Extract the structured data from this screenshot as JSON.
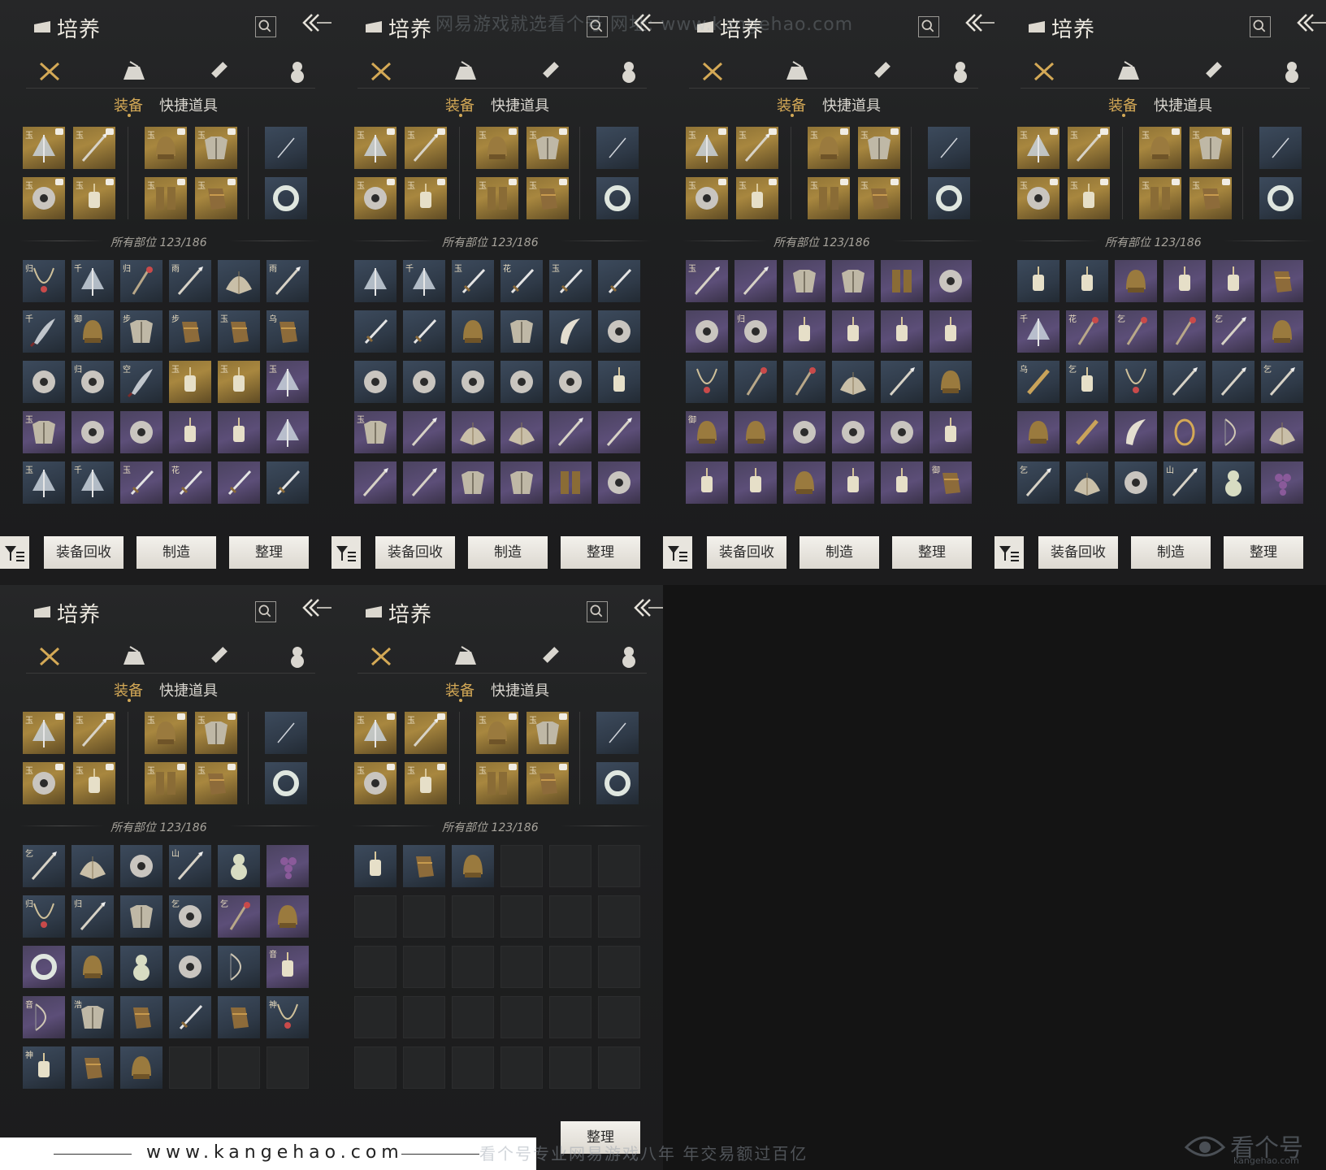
{
  "header": {
    "title": "培养"
  },
  "category_tabs": [
    "swords-icon",
    "pouch-icon",
    "scroll-icon",
    "gourd-icon"
  ],
  "sub_tabs": {
    "equipment": "装备",
    "quick_items": "快捷道具"
  },
  "count_label": "所有部位 123/186",
  "buttons": {
    "recycle": "装备回收",
    "craft": "制造",
    "sort": "整理"
  },
  "watermark": {
    "top": "网易游戏就选看个号  网址: www.kangehao.com",
    "url": "www.kangehao.com",
    "slogan": "看个号专业网易游戏八年  年交易额过百亿",
    "logo": "看个号",
    "logo_sub": "kangehao.com"
  },
  "colors": {
    "accent": "#d4a956",
    "gold_slot": "#a8873f",
    "blue_slot": "#2f3a48",
    "purple_slot": "#5c4e78"
  },
  "equipped": {
    "row1": [
      {
        "rarity": "gold",
        "icon": "umbrella-icon",
        "tag": "玉"
      },
      {
        "rarity": "gold",
        "icon": "spear-icon",
        "tag": "玉"
      },
      {
        "rarity": "gold",
        "icon": "helmet-icon",
        "tag": "玉"
      },
      {
        "rarity": "gold",
        "icon": "armor-icon",
        "tag": "玉"
      },
      {
        "rarity": "blue",
        "icon": "needle-icon",
        "tag": ""
      }
    ],
    "row2": [
      {
        "rarity": "gold",
        "icon": "ring-icon",
        "tag": "玉"
      },
      {
        "rarity": "gold",
        "icon": "pendant-icon",
        "tag": "玉"
      },
      {
        "rarity": "gold",
        "icon": "greaves-icon",
        "tag": "玉"
      },
      {
        "rarity": "gold",
        "icon": "bracer-icon",
        "tag": "玉"
      },
      {
        "rarity": "blue",
        "icon": "bangle-icon",
        "tag": ""
      }
    ]
  },
  "pages": [
    {
      "label": "page-1",
      "cells": [
        [
          "blue",
          "necklace-icon",
          "归"
        ],
        [
          "blue",
          "umbrella-icon",
          "千"
        ],
        [
          "blue",
          "staff-icon",
          "归"
        ],
        [
          "blue",
          "spear-icon",
          "雨"
        ],
        [
          "blue",
          "fan-icon",
          ""
        ],
        [
          "blue",
          "spear-icon",
          "雨"
        ],
        [
          "blue",
          "blade-icon",
          "千"
        ],
        [
          "blue",
          "helmet-icon",
          "御"
        ],
        [
          "blue",
          "armor-icon",
          "步"
        ],
        [
          "blue",
          "bracer-icon",
          "步"
        ],
        [
          "blue",
          "bracer-icon",
          "玉"
        ],
        [
          "blue",
          "bracer-icon",
          "乌"
        ],
        [
          "blue",
          "ring-icon",
          ""
        ],
        [
          "blue",
          "ring-icon",
          "归"
        ],
        [
          "blue",
          "blade-icon",
          "空"
        ],
        [
          "gold",
          "pendant-icon",
          "玉"
        ],
        [
          "gold",
          "pendant-icon",
          "玉"
        ],
        [
          "purple",
          "umbrella-icon",
          "玉"
        ],
        [
          "purple",
          "armor-icon",
          "玉"
        ],
        [
          "purple",
          "ring-icon",
          ""
        ],
        [
          "purple",
          "ring-icon",
          ""
        ],
        [
          "purple",
          "pendant-icon",
          ""
        ],
        [
          "purple",
          "pendant-icon",
          ""
        ],
        [
          "purple",
          "umbrella-icon",
          ""
        ],
        [
          "blue",
          "umbrella-icon",
          "玉"
        ],
        [
          "blue",
          "umbrella-icon",
          "千"
        ],
        [
          "purple",
          "sword-icon",
          "玉"
        ],
        [
          "purple",
          "sword-icon",
          "花"
        ],
        [
          "purple",
          "sword-icon",
          ""
        ],
        [
          "blue",
          "sword-icon",
          ""
        ]
      ]
    },
    {
      "label": "page-2",
      "cells": [
        [
          "blue",
          "umbrella-icon",
          ""
        ],
        [
          "blue",
          "umbrella-icon",
          "千"
        ],
        [
          "blue",
          "sword-icon",
          "玉"
        ],
        [
          "blue",
          "sword-icon",
          "花"
        ],
        [
          "blue",
          "sword-icon",
          "玉"
        ],
        [
          "blue",
          "sword-icon",
          ""
        ],
        [
          "blue",
          "sword-icon",
          ""
        ],
        [
          "blue",
          "sword-icon",
          ""
        ],
        [
          "blue",
          "helmet-icon",
          ""
        ],
        [
          "blue",
          "armor-icon",
          ""
        ],
        [
          "blue",
          "horn-icon",
          ""
        ],
        [
          "blue",
          "ring-icon",
          ""
        ],
        [
          "blue",
          "ring-icon",
          ""
        ],
        [
          "blue",
          "ring-icon",
          ""
        ],
        [
          "blue",
          "ring-icon",
          ""
        ],
        [
          "blue",
          "ring-icon",
          ""
        ],
        [
          "blue",
          "ring-icon",
          ""
        ],
        [
          "blue",
          "pendant-icon",
          ""
        ],
        [
          "purple",
          "armor-icon",
          "玉"
        ],
        [
          "purple",
          "spear-icon",
          ""
        ],
        [
          "purple",
          "fan-icon",
          ""
        ],
        [
          "purple",
          "fan-icon",
          ""
        ],
        [
          "purple",
          "spear-icon",
          ""
        ],
        [
          "purple",
          "spear-icon",
          ""
        ],
        [
          "purple",
          "spear-icon",
          ""
        ],
        [
          "purple",
          "spear-icon",
          ""
        ],
        [
          "purple",
          "armor-icon",
          ""
        ],
        [
          "purple",
          "armor-icon",
          ""
        ],
        [
          "purple",
          "greaves-icon",
          ""
        ],
        [
          "purple",
          "ring-icon",
          ""
        ]
      ]
    },
    {
      "label": "page-3",
      "cells": [
        [
          "purple",
          "spear-icon",
          "玉"
        ],
        [
          "purple",
          "spear-icon",
          ""
        ],
        [
          "purple",
          "armor-icon",
          ""
        ],
        [
          "purple",
          "armor-icon",
          ""
        ],
        [
          "purple",
          "greaves-icon",
          ""
        ],
        [
          "purple",
          "ring-icon",
          ""
        ],
        [
          "purple",
          "ring-icon",
          ""
        ],
        [
          "purple",
          "ring-icon",
          "归"
        ],
        [
          "purple",
          "pendant-icon",
          ""
        ],
        [
          "purple",
          "pendant-icon",
          ""
        ],
        [
          "purple",
          "pendant-icon",
          ""
        ],
        [
          "purple",
          "pendant-icon",
          ""
        ],
        [
          "blue",
          "necklace-icon",
          ""
        ],
        [
          "blue",
          "staff-icon",
          ""
        ],
        [
          "blue",
          "staff-icon",
          ""
        ],
        [
          "blue",
          "fan-icon",
          ""
        ],
        [
          "blue",
          "spear-icon",
          ""
        ],
        [
          "blue",
          "helmet-icon",
          ""
        ],
        [
          "purple",
          "helmet-icon",
          "御"
        ],
        [
          "purple",
          "helmet-icon",
          ""
        ],
        [
          "purple",
          "ring-icon",
          ""
        ],
        [
          "purple",
          "ring-icon",
          ""
        ],
        [
          "purple",
          "ring-icon",
          ""
        ],
        [
          "purple",
          "pendant-icon",
          ""
        ],
        [
          "purple",
          "pendant-icon",
          ""
        ],
        [
          "purple",
          "pendant-icon",
          ""
        ],
        [
          "purple",
          "helmet-icon",
          ""
        ],
        [
          "purple",
          "pendant-icon",
          ""
        ],
        [
          "purple",
          "pendant-icon",
          ""
        ],
        [
          "purple",
          "bracer-icon",
          "御"
        ]
      ]
    },
    {
      "label": "page-4",
      "cells": [
        [
          "blue",
          "pendant-icon",
          ""
        ],
        [
          "blue",
          "pendant-icon",
          ""
        ],
        [
          "purple",
          "helmet-icon",
          ""
        ],
        [
          "purple",
          "pendant-icon",
          ""
        ],
        [
          "purple",
          "pendant-icon",
          ""
        ],
        [
          "purple",
          "bracer-icon",
          ""
        ],
        [
          "purple",
          "umbrella-icon",
          "千"
        ],
        [
          "purple",
          "staff-icon",
          "花"
        ],
        [
          "purple",
          "staff-icon",
          "乞"
        ],
        [
          "purple",
          "staff-icon",
          ""
        ],
        [
          "purple",
          "spear-icon",
          "乞"
        ],
        [
          "purple",
          "helmet-icon",
          ""
        ],
        [
          "blue",
          "flute-icon",
          "乌"
        ],
        [
          "blue",
          "pendant-icon",
          "乞"
        ],
        [
          "blue",
          "necklace-icon",
          ""
        ],
        [
          "blue",
          "spear-icon",
          ""
        ],
        [
          "blue",
          "spear-icon",
          ""
        ],
        [
          "blue",
          "spear-icon",
          "乞"
        ],
        [
          "purple",
          "helmet-icon",
          ""
        ],
        [
          "purple",
          "flute-icon",
          ""
        ],
        [
          "purple",
          "horn-icon",
          ""
        ],
        [
          "purple",
          "cage-icon",
          ""
        ],
        [
          "purple",
          "bow-icon",
          ""
        ],
        [
          "purple",
          "fan-icon",
          ""
        ],
        [
          "blue",
          "spear-icon",
          "乞"
        ],
        [
          "blue",
          "fan-icon",
          ""
        ],
        [
          "blue",
          "ring-icon",
          ""
        ],
        [
          "blue",
          "spear-icon",
          "山"
        ],
        [
          "blue",
          "gourd-icon",
          ""
        ],
        [
          "purple",
          "grapes-icon",
          ""
        ]
      ]
    },
    {
      "label": "page-5",
      "cells": [
        [
          "blue",
          "spear-icon",
          "乞"
        ],
        [
          "blue",
          "fan-icon",
          ""
        ],
        [
          "blue",
          "ring-icon",
          ""
        ],
        [
          "blue",
          "spear-icon",
          "山"
        ],
        [
          "blue",
          "gourd-icon",
          ""
        ],
        [
          "purple",
          "grapes-icon",
          ""
        ],
        [
          "blue",
          "necklace-icon",
          "归"
        ],
        [
          "blue",
          "spear-icon",
          "归"
        ],
        [
          "blue",
          "armor-icon",
          ""
        ],
        [
          "blue",
          "ring-icon",
          "乞"
        ],
        [
          "purple",
          "staff-icon",
          "乞"
        ],
        [
          "purple",
          "helmet-icon",
          ""
        ],
        [
          "purple",
          "bangle-icon",
          ""
        ],
        [
          "blue",
          "helmet-icon",
          ""
        ],
        [
          "blue",
          "gourd-icon",
          ""
        ],
        [
          "blue",
          "ring-icon",
          ""
        ],
        [
          "blue",
          "bow-icon",
          ""
        ],
        [
          "purple",
          "pendant-icon",
          "音"
        ],
        [
          "purple",
          "bow-icon",
          "音"
        ],
        [
          "blue",
          "armor-icon",
          "浩"
        ],
        [
          "blue",
          "bracer-icon",
          ""
        ],
        [
          "blue",
          "sword-icon",
          ""
        ],
        [
          "blue",
          "bracer-icon",
          ""
        ],
        [
          "blue",
          "necklace-icon",
          "神"
        ],
        [
          "blue",
          "pendant-icon",
          "神"
        ],
        [
          "blue",
          "bracer-icon",
          ""
        ],
        [
          "blue",
          "helmet-icon",
          ""
        ],
        [
          "empty",
          "",
          ""
        ],
        [
          "empty",
          "",
          ""
        ],
        [
          "empty",
          "",
          ""
        ]
      ]
    },
    {
      "label": "page-6",
      "cells": [
        [
          "blue",
          "pendant-icon",
          ""
        ],
        [
          "blue",
          "bracer-icon",
          ""
        ],
        [
          "blue",
          "helmet-icon",
          ""
        ],
        [
          "empty",
          "",
          ""
        ],
        [
          "empty",
          "",
          ""
        ],
        [
          "empty",
          "",
          ""
        ],
        [
          "empty",
          "",
          ""
        ],
        [
          "empty",
          "",
          ""
        ],
        [
          "empty",
          "",
          ""
        ],
        [
          "empty",
          "",
          ""
        ],
        [
          "empty",
          "",
          ""
        ],
        [
          "empty",
          "",
          ""
        ],
        [
          "empty",
          "",
          ""
        ],
        [
          "empty",
          "",
          ""
        ],
        [
          "empty",
          "",
          ""
        ],
        [
          "empty",
          "",
          ""
        ],
        [
          "empty",
          "",
          ""
        ],
        [
          "empty",
          "",
          ""
        ],
        [
          "empty",
          "",
          ""
        ],
        [
          "empty",
          "",
          ""
        ],
        [
          "empty",
          "",
          ""
        ],
        [
          "empty",
          "",
          ""
        ],
        [
          "empty",
          "",
          ""
        ],
        [
          "empty",
          "",
          ""
        ],
        [
          "empty",
          "",
          ""
        ],
        [
          "empty",
          "",
          ""
        ],
        [
          "empty",
          "",
          ""
        ],
        [
          "empty",
          "",
          ""
        ],
        [
          "empty",
          "",
          ""
        ],
        [
          "empty",
          "",
          ""
        ]
      ]
    }
  ]
}
